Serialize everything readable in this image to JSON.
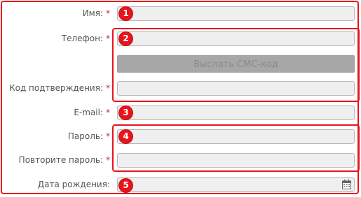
{
  "form": {
    "fields": {
      "name": {
        "label": "Имя:",
        "required": "*",
        "value": ""
      },
      "phone": {
        "label": "Телефон:",
        "required": "*",
        "value": ""
      },
      "sms_button": "Выслать СМС-код",
      "code": {
        "label": "Код подтверждения:",
        "required": "*",
        "value": ""
      },
      "email": {
        "label": "E-mail:",
        "required": "*",
        "value": ""
      },
      "password": {
        "label": "Пароль:",
        "required": "*",
        "value": ""
      },
      "password_repeat": {
        "label": "Повторите пароль:",
        "required": "*",
        "value": ""
      },
      "birthdate": {
        "label": "Дата рождения:",
        "value": "",
        "icon": "calendar-icon"
      }
    }
  },
  "annotations": {
    "badges": [
      "1",
      "2",
      "3",
      "4",
      "5"
    ]
  },
  "colors": {
    "highlight": "#e8141c",
    "required": "#d9222a",
    "field_bg": "#efefef",
    "button_bg": "#a7a7a7"
  }
}
